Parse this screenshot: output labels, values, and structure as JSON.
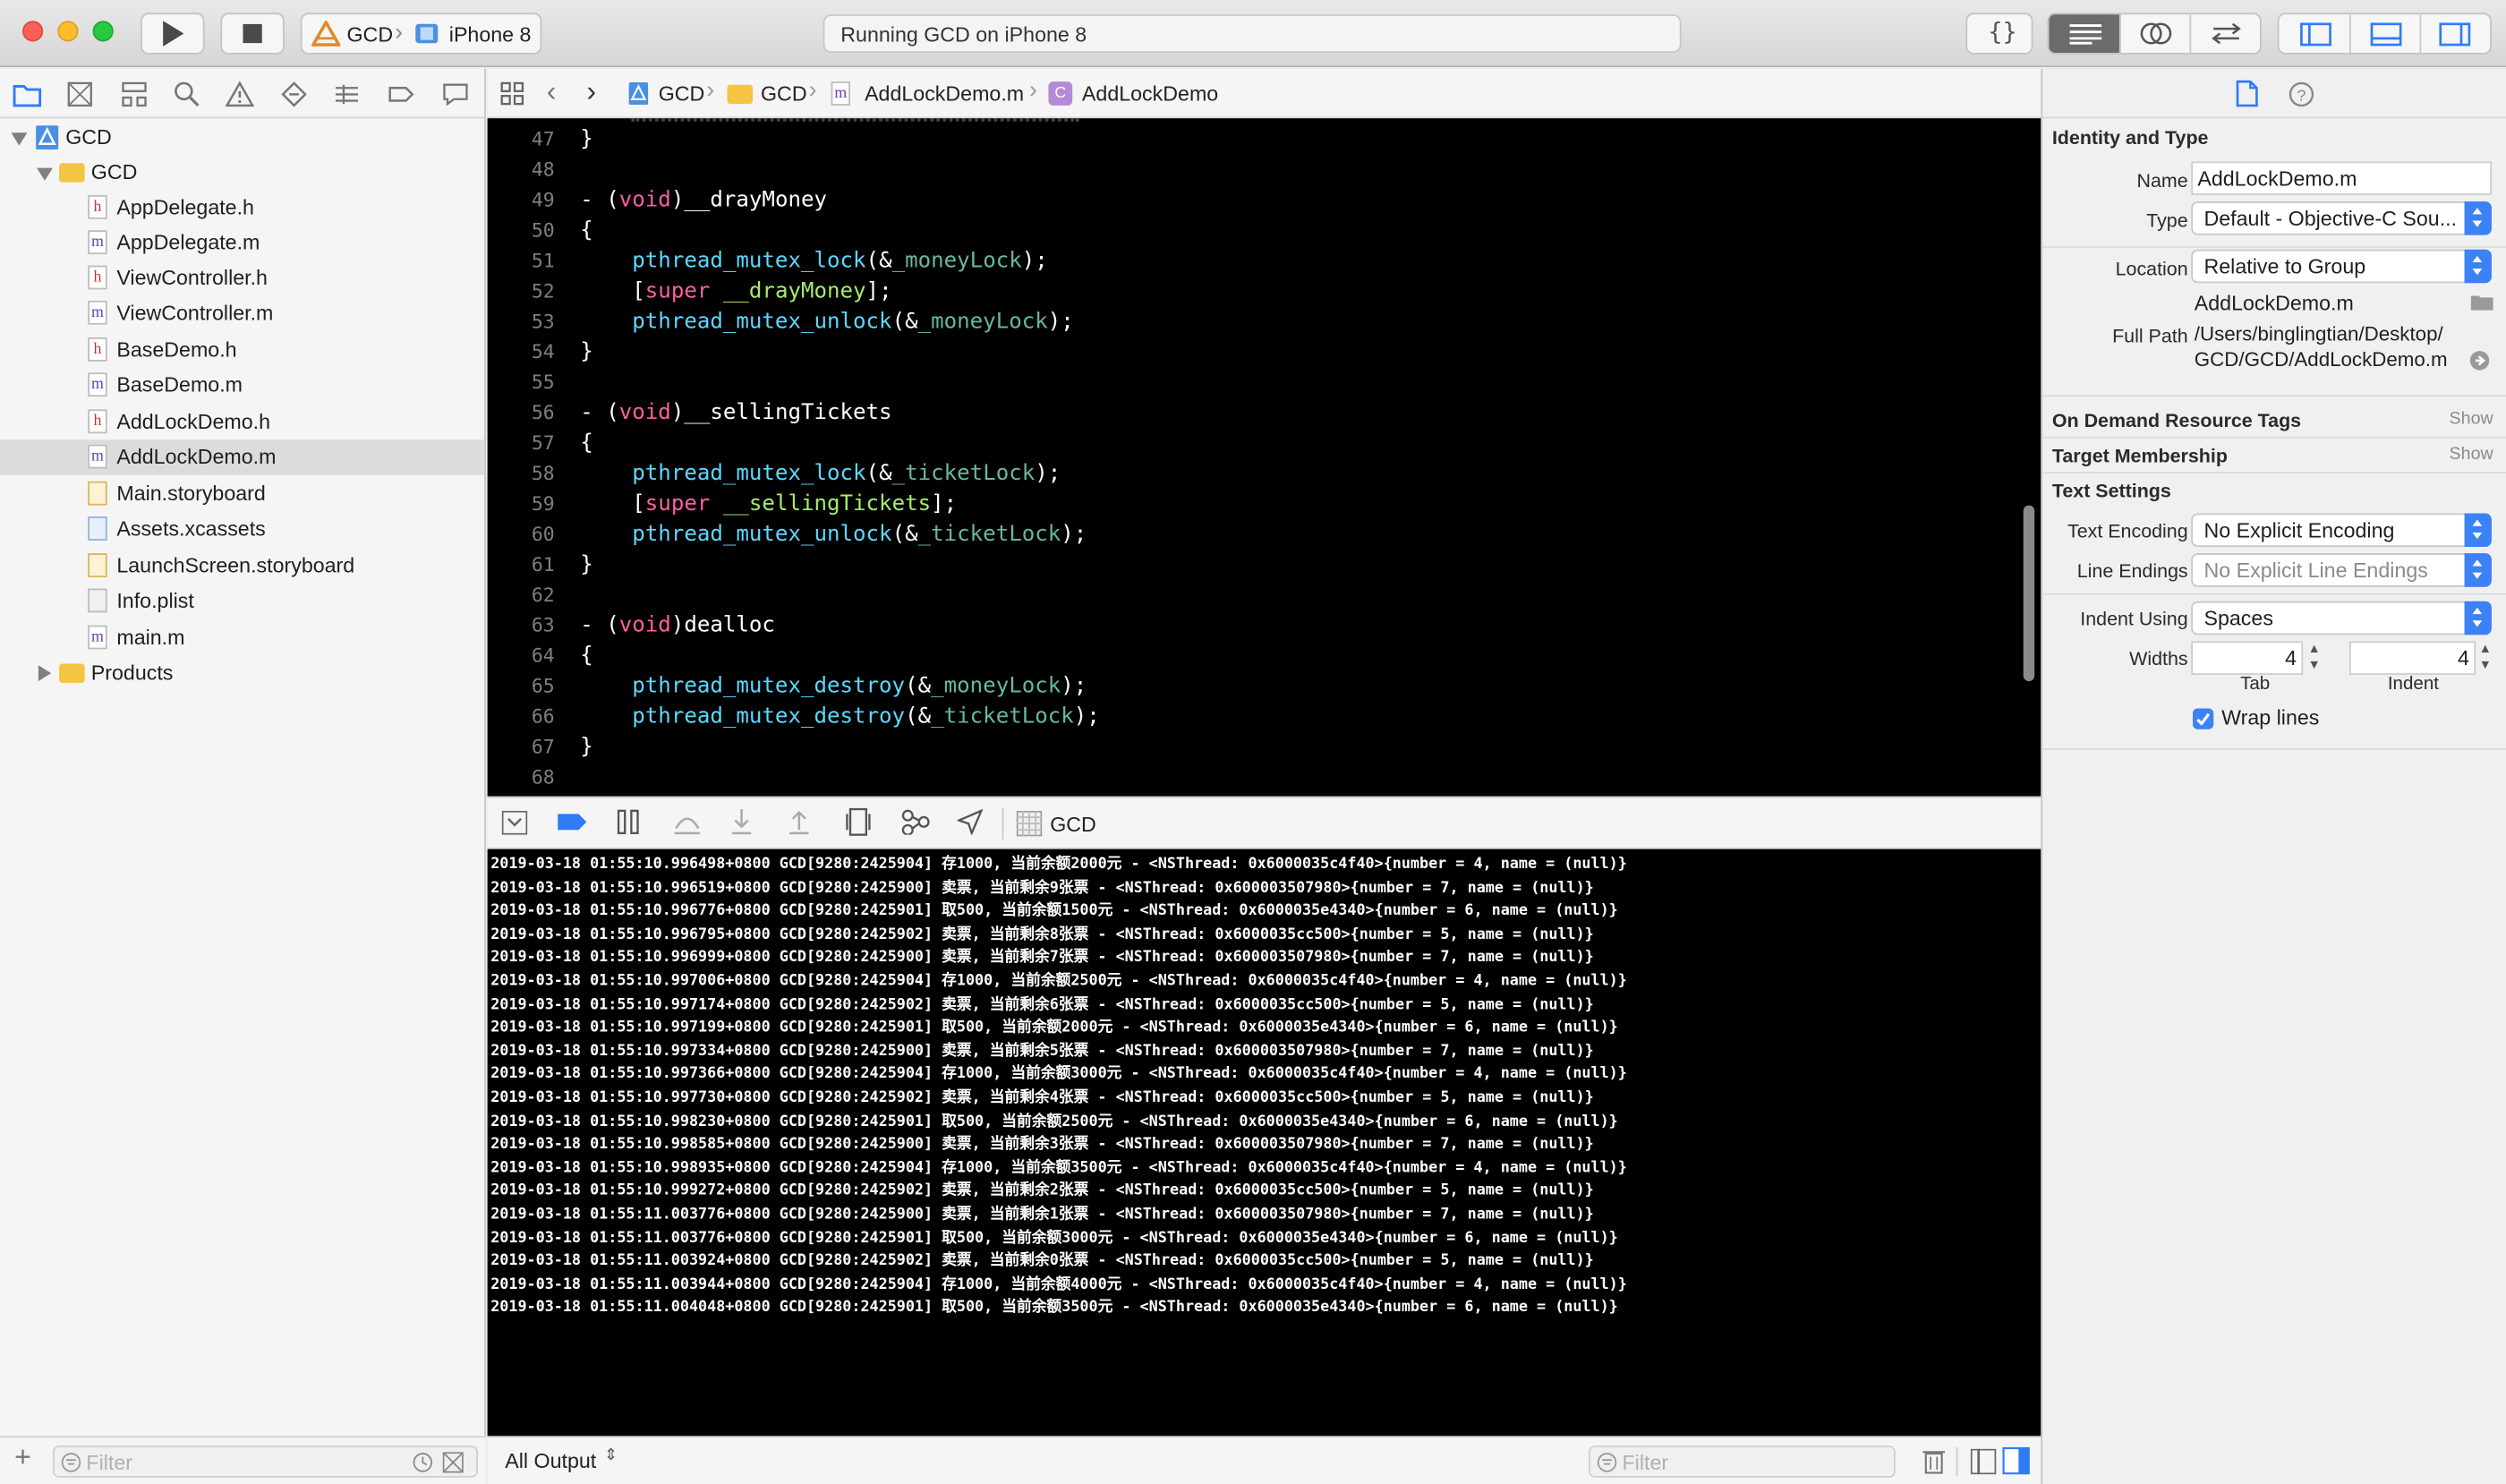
{
  "window": {
    "scheme_project": "GCD",
    "scheme_device": "iPhone 8",
    "status": "Running GCD on iPhone 8"
  },
  "navigator": {
    "items": [
      {
        "label": "GCD",
        "kind": "project"
      },
      {
        "label": "GCD",
        "kind": "folder"
      },
      {
        "label": "AppDelegate.h",
        "kind": "h"
      },
      {
        "label": "AppDelegate.m",
        "kind": "m"
      },
      {
        "label": "ViewController.h",
        "kind": "h"
      },
      {
        "label": "ViewController.m",
        "kind": "m"
      },
      {
        "label": "BaseDemo.h",
        "kind": "h"
      },
      {
        "label": "BaseDemo.m",
        "kind": "m"
      },
      {
        "label": "AddLockDemo.h",
        "kind": "h"
      },
      {
        "label": "AddLockDemo.m",
        "kind": "m",
        "selected": true
      },
      {
        "label": "Main.storyboard",
        "kind": "storyboard"
      },
      {
        "label": "Assets.xcassets",
        "kind": "assets"
      },
      {
        "label": "LaunchScreen.storyboard",
        "kind": "storyboard"
      },
      {
        "label": "Info.plist",
        "kind": "plist"
      },
      {
        "label": "main.m",
        "kind": "m"
      },
      {
        "label": "Products",
        "kind": "folder"
      }
    ],
    "filter_placeholder": "Filter"
  },
  "jumpbar": {
    "crumbs": [
      "GCD",
      "GCD",
      "AddLockDemo.m",
      "AddLockDemo"
    ]
  },
  "editor": {
    "lines": [
      {
        "n": "47",
        "t": "}"
      },
      {
        "n": "48",
        "t": ""
      },
      {
        "n": "49",
        "t": "- (void)__drayMoney"
      },
      {
        "n": "50",
        "t": "{"
      },
      {
        "n": "51",
        "t": "    pthread_mutex_lock(&_moneyLock);"
      },
      {
        "n": "52",
        "t": "    [super __drayMoney];"
      },
      {
        "n": "53",
        "t": "    pthread_mutex_unlock(&_moneyLock);"
      },
      {
        "n": "54",
        "t": "}"
      },
      {
        "n": "55",
        "t": ""
      },
      {
        "n": "56",
        "t": "- (void)__sellingTickets"
      },
      {
        "n": "57",
        "t": "{"
      },
      {
        "n": "58",
        "t": "    pthread_mutex_lock(&_ticketLock);"
      },
      {
        "n": "59",
        "t": "    [super __sellingTickets];"
      },
      {
        "n": "60",
        "t": "    pthread_mutex_unlock(&_ticketLock);"
      },
      {
        "n": "61",
        "t": "}"
      },
      {
        "n": "62",
        "t": ""
      },
      {
        "n": "63",
        "t": "- (void)dealloc"
      },
      {
        "n": "64",
        "t": "{"
      },
      {
        "n": "65",
        "t": "    pthread_mutex_destroy(&_moneyLock);"
      },
      {
        "n": "66",
        "t": "    pthread_mutex_destroy(&_ticketLock);"
      },
      {
        "n": "67",
        "t": "}"
      },
      {
        "n": "68",
        "t": ""
      }
    ]
  },
  "debugbar": {
    "process": "GCD"
  },
  "console": {
    "lines": [
      "2019-03-18 01:55:10.996498+0800 GCD[9280:2425904] 存1000, 当前余额2000元 - <NSThread: 0x6000035c4f40>{number = 4, name = (null)}",
      "2019-03-18 01:55:10.996519+0800 GCD[9280:2425900] 卖票, 当前剩余9张票 - <NSThread: 0x600003507980>{number = 7, name = (null)}",
      "2019-03-18 01:55:10.996776+0800 GCD[9280:2425901] 取500, 当前余额1500元 - <NSThread: 0x6000035e4340>{number = 6, name = (null)}",
      "2019-03-18 01:55:10.996795+0800 GCD[9280:2425902] 卖票, 当前剩余8张票 - <NSThread: 0x6000035cc500>{number = 5, name = (null)}",
      "2019-03-18 01:55:10.996999+0800 GCD[9280:2425900] 卖票, 当前剩余7张票 - <NSThread: 0x600003507980>{number = 7, name = (null)}",
      "2019-03-18 01:55:10.997006+0800 GCD[9280:2425904] 存1000, 当前余额2500元 - <NSThread: 0x6000035c4f40>{number = 4, name = (null)}",
      "2019-03-18 01:55:10.997174+0800 GCD[9280:2425902] 卖票, 当前剩余6张票 - <NSThread: 0x6000035cc500>{number = 5, name = (null)}",
      "2019-03-18 01:55:10.997199+0800 GCD[9280:2425901] 取500, 当前余额2000元 - <NSThread: 0x6000035e4340>{number = 6, name = (null)}",
      "2019-03-18 01:55:10.997334+0800 GCD[9280:2425900] 卖票, 当前剩余5张票 - <NSThread: 0x600003507980>{number = 7, name = (null)}",
      "2019-03-18 01:55:10.997366+0800 GCD[9280:2425904] 存1000, 当前余额3000元 - <NSThread: 0x6000035c4f40>{number = 4, name = (null)}",
      "2019-03-18 01:55:10.997730+0800 GCD[9280:2425902] 卖票, 当前剩余4张票 - <NSThread: 0x6000035cc500>{number = 5, name = (null)}",
      "2019-03-18 01:55:10.998230+0800 GCD[9280:2425901] 取500, 当前余额2500元 - <NSThread: 0x6000035e4340>{number = 6, name = (null)}",
      "2019-03-18 01:55:10.998585+0800 GCD[9280:2425900] 卖票, 当前剩余3张票 - <NSThread: 0x600003507980>{number = 7, name = (null)}",
      "2019-03-18 01:55:10.998935+0800 GCD[9280:2425904] 存1000, 当前余额3500元 - <NSThread: 0x6000035c4f40>{number = 4, name = (null)}",
      "2019-03-18 01:55:10.999272+0800 GCD[9280:2425902] 卖票, 当前剩余2张票 - <NSThread: 0x6000035cc500>{number = 5, name = (null)}",
      "2019-03-18 01:55:11.003776+0800 GCD[9280:2425900] 卖票, 当前剩余1张票 - <NSThread: 0x600003507980>{number = 7, name = (null)}",
      "2019-03-18 01:55:11.003776+0800 GCD[9280:2425901] 取500, 当前余额3000元 - <NSThread: 0x6000035e4340>{number = 6, name = (null)}",
      "2019-03-18 01:55:11.003924+0800 GCD[9280:2425902] 卖票, 当前剩余0张票 - <NSThread: 0x6000035cc500>{number = 5, name = (null)}",
      "2019-03-18 01:55:11.003944+0800 GCD[9280:2425904] 存1000, 当前余额4000元 - <NSThread: 0x6000035c4f40>{number = 4, name = (null)}",
      "2019-03-18 01:55:11.004048+0800 GCD[9280:2425901] 取500, 当前余额3500元 - <NSThread: 0x6000035e4340>{number = 6, name = (null)}"
    ],
    "output_selector": "All Output",
    "filter_placeholder": "Filter"
  },
  "inspector": {
    "identity_title": "Identity and Type",
    "name_label": "Name",
    "name_value": "AddLockDemo.m",
    "type_label": "Type",
    "type_value": "Default - Objective-C Sou...",
    "location_label": "Location",
    "location_value": "Relative to Group",
    "location_file": "AddLockDemo.m",
    "fullpath_label": "Full Path",
    "fullpath_value_1": "/Users/binglingtian/Desktop/",
    "fullpath_value_2": "GCD/GCD/AddLockDemo.m",
    "odr_title": "On Demand Resource Tags",
    "odr_show": "Show",
    "target_title": "Target Membership",
    "target_show": "Show",
    "text_title": "Text Settings",
    "encoding_label": "Text Encoding",
    "encoding_value": "No Explicit Encoding",
    "endings_label": "Line Endings",
    "endings_value": "No Explicit Line Endings",
    "indent_label": "Indent Using",
    "indent_value": "Spaces",
    "widths_label": "Widths",
    "tab_value": "4",
    "indent_width_value": "4",
    "tab_caption": "Tab",
    "indent_caption": "Indent",
    "wrap_label": "Wrap lines",
    "wrap_checked": true
  },
  "colors": {
    "keyword": "#fc5fa3",
    "function": "#5dd8ff",
    "ivar": "#67b7a4",
    "method": "#a7eb6d",
    "accent": "#3b82f6"
  }
}
